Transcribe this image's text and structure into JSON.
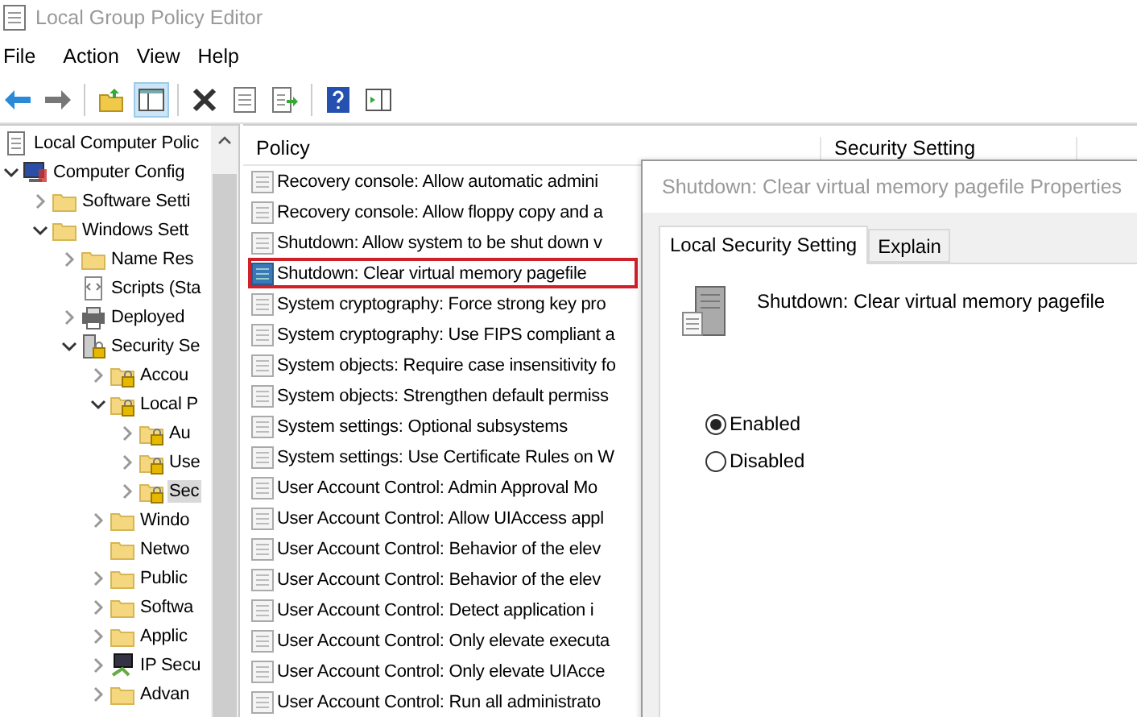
{
  "window": {
    "title": "Local Group Policy Editor"
  },
  "menu": [
    "File",
    "Action",
    "View",
    "Help"
  ],
  "toolbar": [
    {
      "kind": "back",
      "selected": false
    },
    {
      "kind": "forward",
      "selected": false
    },
    {
      "kind": "up",
      "selected": false
    },
    {
      "kind": "tree",
      "selected": true
    },
    {
      "kind": "delete",
      "selected": false
    },
    {
      "kind": "properties",
      "selected": false
    },
    {
      "kind": "export",
      "selected": false
    },
    {
      "kind": "help",
      "selected": false
    },
    {
      "kind": "view",
      "selected": false
    }
  ],
  "tree": [
    {
      "label": "Local Computer Polic",
      "kind": "doc",
      "selected": false,
      "children": [
        {
          "label": "Computer Config",
          "kind": "computer",
          "expanded": true,
          "selected": false,
          "children": [
            {
              "label": "Software Setti",
              "kind": "folder",
              "expanded": false,
              "selected": false
            },
            {
              "label": "Windows Sett",
              "kind": "folder",
              "expanded": true,
              "selected": false,
              "children": [
                {
                  "label": "Name Res",
                  "kind": "folder",
                  "expanded": false,
                  "selected": false
                },
                {
                  "label": "Scripts (Sta",
                  "kind": "script",
                  "selected": false
                },
                {
                  "label": "Deployed",
                  "kind": "printer",
                  "expanded": false,
                  "selected": false
                },
                {
                  "label": "Security Se",
                  "kind": "secure",
                  "expanded": true,
                  "selected": false,
                  "children": [
                    {
                      "label": "Accou",
                      "kind": "lockfolder",
                      "expanded": false,
                      "selected": false
                    },
                    {
                      "label": "Local P",
                      "kind": "lockfolder",
                      "expanded": true,
                      "selected": false,
                      "children": [
                        {
                          "label": "Au",
                          "kind": "lockfolder",
                          "expanded": false,
                          "selected": false
                        },
                        {
                          "label": "Use",
                          "kind": "lockfolder",
                          "expanded": false,
                          "selected": false
                        },
                        {
                          "label": "Sec",
                          "kind": "lockfolder",
                          "expanded": false,
                          "selected": true
                        }
                      ]
                    },
                    {
                      "label": "Windo",
                      "kind": "folder",
                      "expanded": false,
                      "selected": false
                    },
                    {
                      "label": "Netwo",
                      "kind": "folder",
                      "selected": false
                    },
                    {
                      "label": "Public",
                      "kind": "folder",
                      "expanded": false,
                      "selected": false
                    },
                    {
                      "label": "Softwa",
                      "kind": "folder",
                      "expanded": false,
                      "selected": false
                    },
                    {
                      "label": "Applic",
                      "kind": "folder",
                      "expanded": false,
                      "selected": false
                    },
                    {
                      "label": "IP Secu",
                      "kind": "network",
                      "expanded": false,
                      "selected": false
                    },
                    {
                      "label": "Advan",
                      "kind": "folder",
                      "expanded": false,
                      "selected": false
                    }
                  ]
                }
              ]
            }
          ]
        }
      ]
    }
  ],
  "list": {
    "columns": [
      "Policy",
      "Security Setting"
    ],
    "rows": [
      {
        "policy": "Recovery console: Allow automatic admini",
        "selected": false
      },
      {
        "policy": "Recovery console: Allow floppy copy and a",
        "selected": false
      },
      {
        "policy": "Shutdown: Allow system to be shut down v",
        "selected": false
      },
      {
        "policy": "Shutdown: Clear virtual memory pagefile",
        "selected": true
      },
      {
        "policy": "System cryptography: Force strong key pro",
        "selected": false
      },
      {
        "policy": "System cryptography: Use FIPS compliant a",
        "selected": false
      },
      {
        "policy": "System objects: Require case insensitivity fo",
        "selected": false
      },
      {
        "policy": "System objects: Strengthen default permiss",
        "selected": false
      },
      {
        "policy": "System settings: Optional subsystems",
        "selected": false
      },
      {
        "policy": "System settings: Use Certificate Rules on W",
        "selected": false
      },
      {
        "policy": "User Account Control: Admin Approval Mo",
        "selected": false
      },
      {
        "policy": "User Account Control: Allow UIAccess appl",
        "selected": false
      },
      {
        "policy": "User Account Control: Behavior of the elev",
        "selected": false
      },
      {
        "policy": "User Account Control: Behavior of the elev",
        "selected": false
      },
      {
        "policy": "User Account Control: Detect application i",
        "selected": false
      },
      {
        "policy": "User Account Control: Only elevate executa",
        "selected": false
      },
      {
        "policy": "User Account Control: Only elevate UIAcce",
        "selected": false
      },
      {
        "policy": "User Account Control: Run all administrato",
        "selected": false
      }
    ]
  },
  "dialog": {
    "title": "Shutdown: Clear virtual memory pagefile Properties",
    "tabs": [
      {
        "label": "Local Security Setting",
        "selected": true
      },
      {
        "label": "Explain",
        "selected": false
      }
    ],
    "policy_name": "Shutdown: Clear virtual memory pagefile",
    "options": [
      {
        "label": "Enabled",
        "selected": true
      },
      {
        "label": "Disabled",
        "selected": false
      }
    ]
  }
}
